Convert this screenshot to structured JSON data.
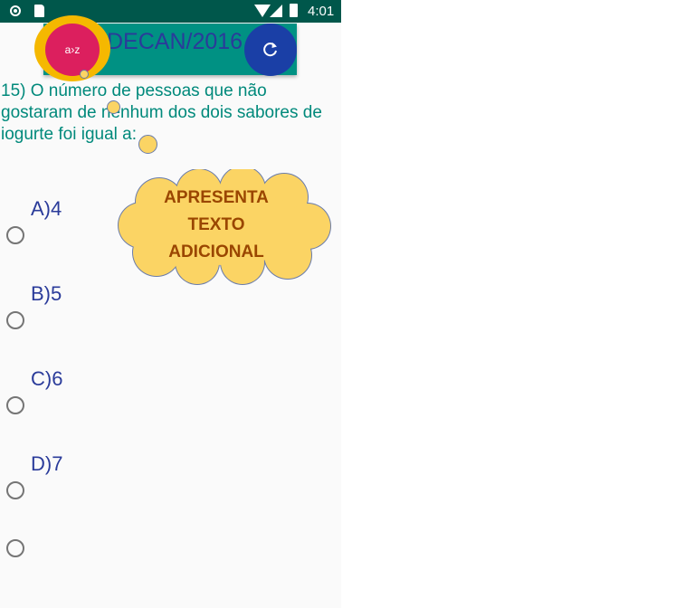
{
  "status_bar": {
    "time": "4:01",
    "icons": [
      "notification-circle-icon",
      "sd-card-icon",
      "wifi-icon",
      "signal-icon",
      "battery-icon"
    ]
  },
  "header": {
    "title": "DECAN/2016",
    "az_button_label": "a›z",
    "refresh_icon": "refresh-icon"
  },
  "question": {
    "text": "15) O número de pessoas que não gostaram de nenhum dos dois sabores de iogurte foi igual a:"
  },
  "callout": {
    "lines": [
      "APRESENTA",
      "TEXTO",
      "ADICIONAL"
    ]
  },
  "options": [
    {
      "label": "A)4",
      "checked": false
    },
    {
      "label": "B)5",
      "checked": false
    },
    {
      "label": "C)6",
      "checked": false
    },
    {
      "label": "D)7",
      "checked": false
    },
    {
      "label": "",
      "checked": false
    }
  ],
  "colors": {
    "status_bar": "#00574b",
    "titlebar": "#009183",
    "title_text": "#2a3b9a",
    "az_button": "#dc1f5e",
    "az_ring": "#f5b800",
    "refresh_button": "#1a3fa6",
    "question_text": "#00897b",
    "option_text": "#2a3b9a",
    "callout_fill": "#fbd464",
    "callout_text": "#9a4600"
  }
}
